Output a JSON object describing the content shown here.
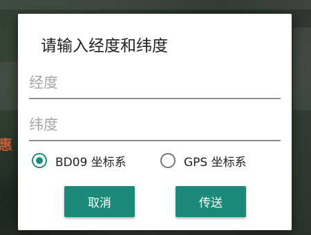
{
  "background": {
    "map_label": "惠"
  },
  "dialog": {
    "title": "请输入经度和纬度",
    "longitude_field": {
      "value": "",
      "placeholder": "经度"
    },
    "latitude_field": {
      "value": "",
      "placeholder": "纬度"
    },
    "coordinate_system": {
      "options": [
        {
          "label": "BD09 坐标系",
          "checked": true
        },
        {
          "label": "GPS 坐标系",
          "checked": false
        }
      ]
    },
    "cancel_label": "取消",
    "send_label": "传送"
  },
  "colors": {
    "accent": "#1b8a78",
    "dialog_bg": "#ffffff",
    "underline": "#8e8e8e",
    "placeholder": "#a6a6a6",
    "map_label": "#c2603a"
  }
}
